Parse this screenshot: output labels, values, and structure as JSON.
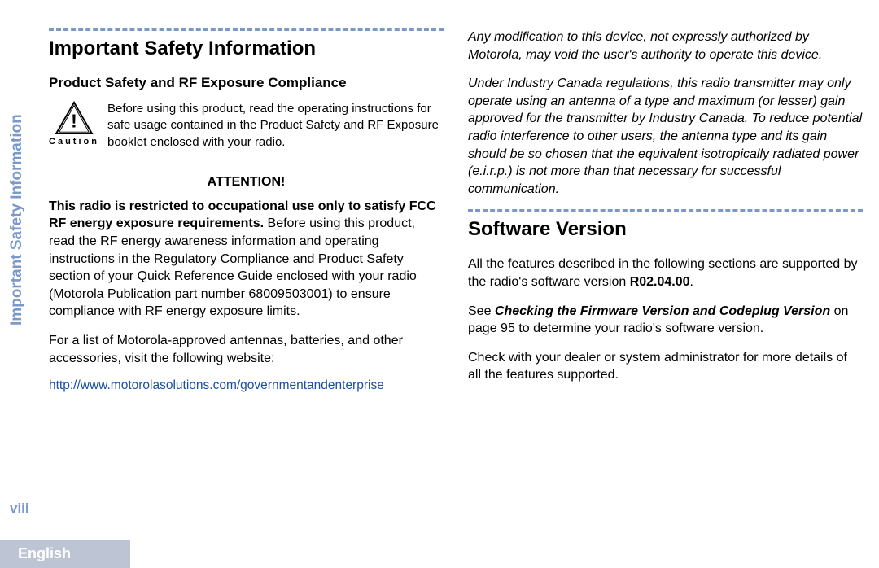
{
  "sidebar": {
    "title": "Important Safety Information",
    "page_number": "viii",
    "language": "English"
  },
  "left_column": {
    "heading": "Important Safety Information",
    "subheading": "Product Safety and RF Exposure Compliance",
    "caution_label": "Caution",
    "caution_text": "Before using this product, read the operating instructions for safe usage contained in the Product Safety and RF Exposure booklet enclosed with your radio.",
    "attention_label": "ATTENTION!",
    "attention_bold": "This radio is restricted to occupational use only to satisfy FCC RF energy exposure requirements.",
    "attention_rest": " Before using this product, read the RF energy awareness information and operating instructions in the Regulatory Compliance and Product Safety section of your Quick Reference Guide enclosed with your radio (Motorola Publication part number 68009503001) to ensure compliance with RF energy exposure limits.",
    "accessories_para": "For a list of Motorola-approved antennas, batteries, and other accessories, visit the following website:",
    "link_text": "http://www.motorolasolutions.com/governmentandenterprise",
    "link_href": "http://www.motorolasolutions.com/governmentandenterprise"
  },
  "right_column": {
    "para1": "Any modification to this device, not expressly authorized by Motorola, may void the user's authority to operate this device.",
    "para2": "Under Industry Canada regulations, this radio transmitter may only operate using an antenna of a type and maximum (or lesser) gain approved for the transmitter by Industry Canada. To reduce potential radio interference to other users, the antenna type and its gain should be so chosen that the equivalent isotropically radiated power (e.i.r.p.) is not more than that necessary for successful communication.",
    "heading": "Software Version",
    "sv_para1_a": "All the features described in the following sections are supported by the radio's software version ",
    "sv_para1_b": "R02.04.00",
    "sv_para1_c": ".",
    "sv_para2_a": "See ",
    "sv_para2_b": "Checking the Firmware Version and Codeplug Version",
    "sv_para2_c": " on page 95 to determine your radio's software version.",
    "sv_para3": "Check with your dealer or system administrator for more details of all the features supported."
  }
}
